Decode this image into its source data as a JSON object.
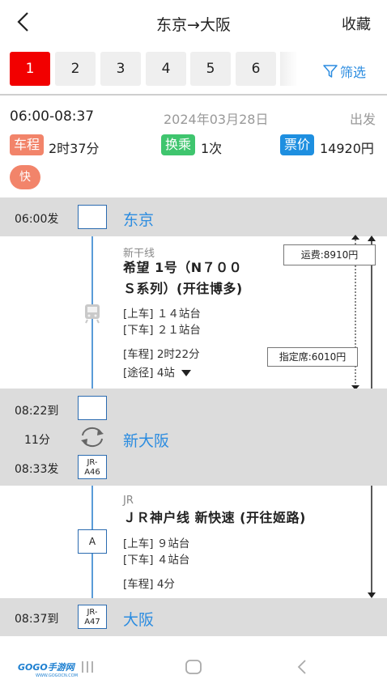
{
  "header": {
    "title": "东京→大阪",
    "favorite": "收藏"
  },
  "tabs": [
    "1",
    "2",
    "3",
    "4",
    "5",
    "6"
  ],
  "filter": "筛选",
  "summary": {
    "time_range": "06:00-08:37",
    "date": "2024年03月28日",
    "depart_label": "出发",
    "duration_label": "车程",
    "duration_value": "2时37分",
    "transfer_label": "换乘",
    "transfer_value": "1次",
    "price_label": "票价",
    "price_value": "14920円",
    "fast_badge": "快"
  },
  "stations": [
    {
      "time": "06:00发",
      "name": "东京"
    },
    {
      "arrive": "08:22到",
      "wait": "11分",
      "depart": "08:33发",
      "name": "新大阪",
      "code": [
        "JR-",
        "A46"
      ]
    },
    {
      "time": "08:37到",
      "name": "大阪",
      "code": [
        "JR-",
        "A47"
      ]
    }
  ],
  "segments": [
    {
      "line": "新干线",
      "train": [
        "希望 1号（N７００",
        "Ｓ系列）(开往博多)"
      ],
      "board": "[上车] １４站台",
      "alight": "[下车] ２１站台",
      "duration": "[车程] 2时22分",
      "via": "[途径] 4站"
    },
    {
      "line": "JR",
      "train": [
        "ＪＲ神户线 新快速 (开往姬路)"
      ],
      "board": "[上车] ９站台",
      "alight": "[下车] ４站台",
      "duration": "[车程] 4分",
      "stop_code": "A"
    }
  ],
  "fares": {
    "fare": "运费:8910円",
    "reserved": "指定席:6010円"
  },
  "footer": {
    "logo": "GOGO手游网",
    "logo_url": "WWW.GOGOCN.COM"
  },
  "colors": {
    "accent": "#2b8ce0",
    "active_tab": "#f20000",
    "duration_chip": "#f2846a",
    "transfer_chip": "#3fc56e",
    "price_chip": "#1e8fe0"
  }
}
